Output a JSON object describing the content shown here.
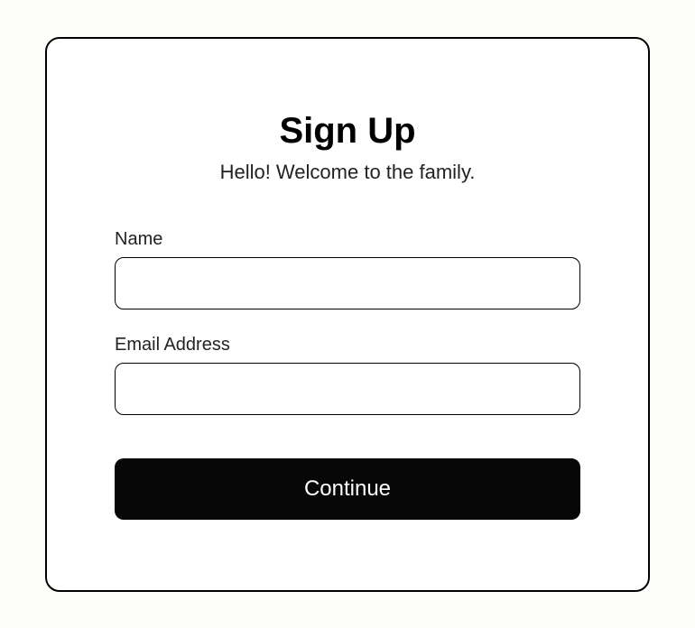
{
  "header": {
    "title": "Sign Up",
    "subtitle": "Hello! Welcome to the family."
  },
  "fields": {
    "name": {
      "label": "Name",
      "value": ""
    },
    "email": {
      "label": "Email Address",
      "value": ""
    }
  },
  "button": {
    "label": "Continue"
  }
}
